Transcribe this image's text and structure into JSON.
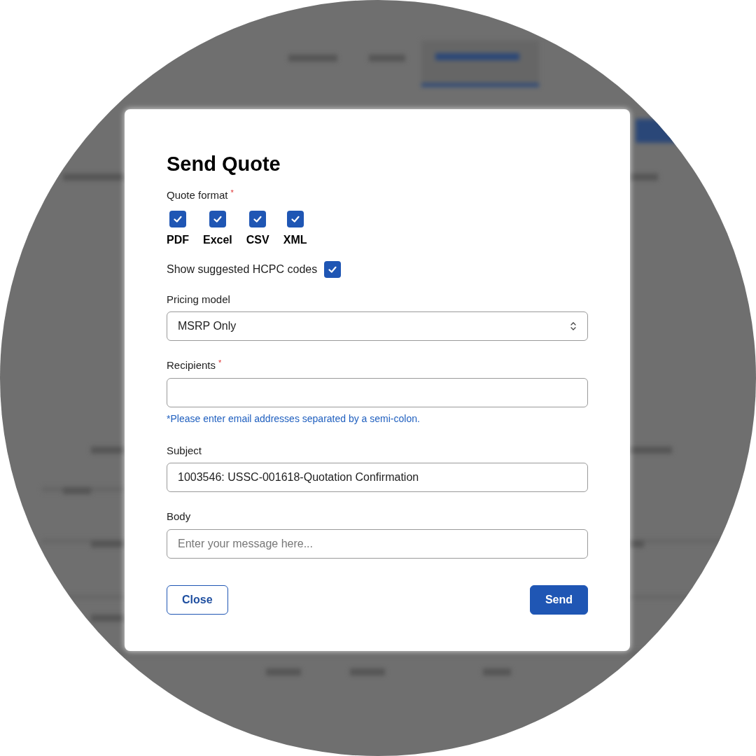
{
  "dialog": {
    "title": "Send Quote",
    "quote_format": {
      "label": "Quote format",
      "required_mark": "*",
      "options": [
        {
          "label": "PDF",
          "checked": true
        },
        {
          "label": "Excel",
          "checked": true
        },
        {
          "label": "CSV",
          "checked": true
        },
        {
          "label": "XML",
          "checked": true
        }
      ]
    },
    "hcpc": {
      "label": "Show suggested HCPC codes",
      "checked": true
    },
    "pricing_model": {
      "label": "Pricing model",
      "value": "MSRP Only"
    },
    "recipients": {
      "label": "Recipients",
      "required_mark": "*",
      "hint": "*Please enter email addresses separated by a semi-colon."
    },
    "subject": {
      "label": "Subject",
      "value": "1003546: USSC-001618-Quotation Confirmation"
    },
    "body": {
      "label": "Body",
      "placeholder": "Enter your message here..."
    },
    "buttons": [
      {
        "label": "Close",
        "kind": "secondary"
      },
      {
        "label": "Send",
        "kind": "primary"
      }
    ]
  }
}
